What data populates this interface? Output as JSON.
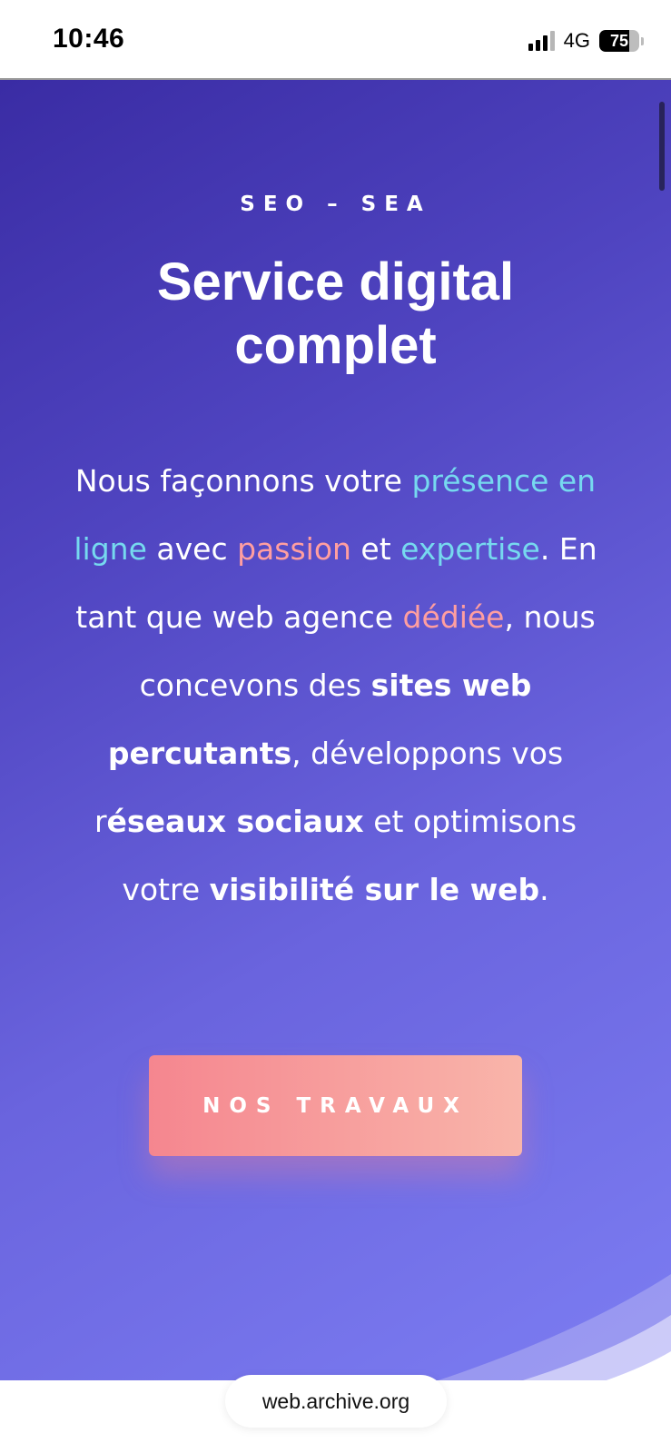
{
  "status_bar": {
    "time": "10:46",
    "network": "4G",
    "battery": "75"
  },
  "hero": {
    "eyebrow": "SEO – SEA",
    "title_line1": "Service digital",
    "title_line2": "complet",
    "paragraph": {
      "t1": "Nous façonnons votre ",
      "h1": "présence en ligne",
      "t2": " avec ",
      "h2": "passion",
      "t3": " et ",
      "h3": "expertise",
      "t4": ". En tant que web agence ",
      "h4": "dédiée",
      "t5": ", nous concevons des ",
      "b1": "sites web percutants",
      "t6": ", développons vos r",
      "b2": "éseaux sociaux",
      "t7": " et optimisons votre ",
      "b3": "visibilité sur le web",
      "t8": "."
    },
    "cta_label": "NOS TRAVAUX"
  },
  "browser": {
    "url": "web.archive.org"
  },
  "colors": {
    "accent_cyan": "#76d9ef",
    "accent_salmon": "#ff9ea0",
    "gradient_start": "#3a2ca4",
    "gradient_end": "#7c7df2"
  }
}
